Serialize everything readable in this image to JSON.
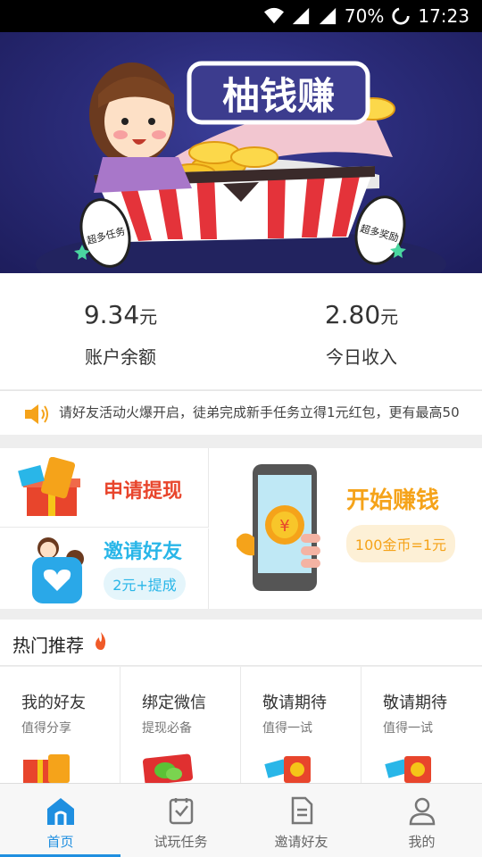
{
  "status_bar": {
    "battery": "70%",
    "time": "17:23"
  },
  "banner": {
    "title": "柚钱赚",
    "left_tag": "超多任务",
    "right_tag": "超多奖励"
  },
  "stats": [
    {
      "value": "9.34",
      "unit": "元",
      "label": "账户余额"
    },
    {
      "value": "2.80",
      "unit": "元",
      "label": "今日收入"
    }
  ],
  "notice": {
    "text": "请好友活动火爆开启，徒弟完成新手任务立得1元红包，更有最高50"
  },
  "grid": {
    "withdraw": {
      "title": "申请提现"
    },
    "invite": {
      "title": "邀请好友",
      "pill": "2元+提成"
    },
    "earn": {
      "title": "开始赚钱",
      "pill": "100金币=1元"
    }
  },
  "hot": {
    "title": "热门推荐"
  },
  "cards": [
    {
      "title": "我的好友",
      "subtitle": "值得分享"
    },
    {
      "title": "绑定微信",
      "subtitle": "提现必备"
    },
    {
      "title": "敬请期待",
      "subtitle": "值得一试"
    },
    {
      "title": "敬请期待",
      "subtitle": "值得一试"
    }
  ],
  "tabs": [
    {
      "label": "首页",
      "icon": "home-icon",
      "active": true
    },
    {
      "label": "试玩任务",
      "icon": "task-icon",
      "active": false
    },
    {
      "label": "邀请好友",
      "icon": "invite-doc-icon",
      "active": false
    },
    {
      "label": "我的",
      "icon": "profile-icon",
      "active": false
    }
  ],
  "colors": {
    "accent": "#1f8fe0",
    "red": "#e8452c",
    "orange": "#f5a31a",
    "cyan": "#29b6e8"
  }
}
